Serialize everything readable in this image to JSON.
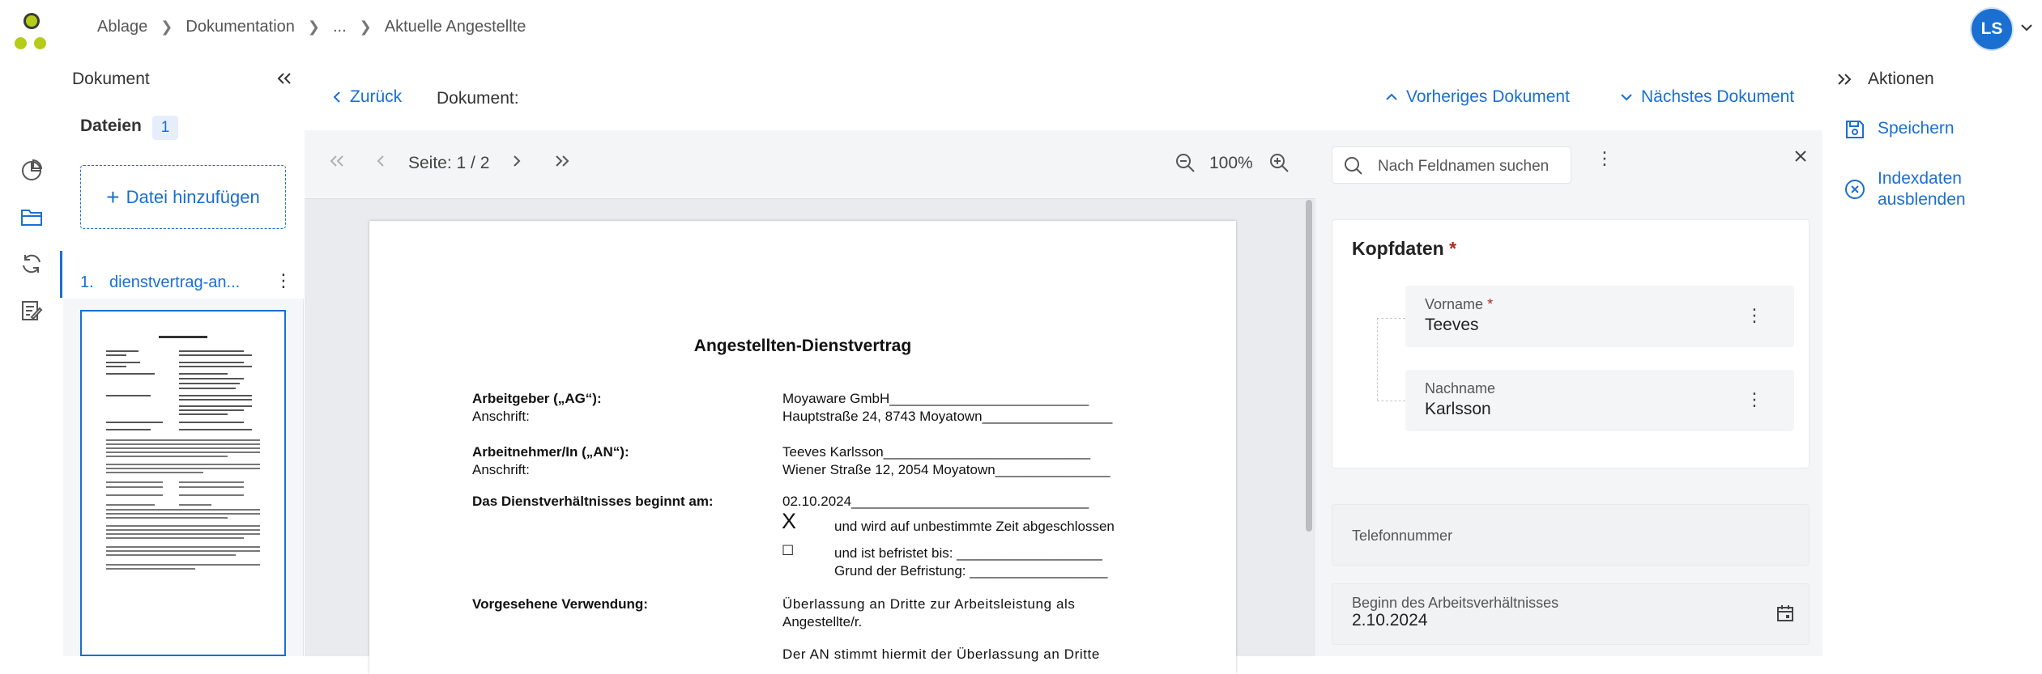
{
  "breadcrumb": [
    "Ablage",
    "Dokumentation",
    "...",
    "Aktuelle Angestellte"
  ],
  "user": {
    "initials": "LS"
  },
  "colors": {
    "accent": "#1a6fd1",
    "logo_dark": "#3a3a3a",
    "logo_green": "#b5cc18",
    "required": "#b3261e"
  },
  "rail_icons": [
    "pie-chart-icon",
    "folder-icon",
    "refresh-icon",
    "checklist-edit-icon"
  ],
  "doc_panel": {
    "title": "Dokument",
    "files_title": "Dateien",
    "files_count": "1",
    "add_file": "Datei hinzufügen",
    "file": {
      "num": "1.",
      "name": "dienstvertrag-an..."
    }
  },
  "header": {
    "back": "Zurück",
    "document_label": "Dokument:",
    "prev": "Vorheriges Dokument",
    "next": "Nächstes Dokument"
  },
  "viewer": {
    "page": "Seite: 1 / 2",
    "zoom": "100%"
  },
  "document": {
    "title": "Angestellten-Dienstvertrag",
    "employer_label": "Arbeitgeber („AG“):",
    "employer_addr_label": "Anschrift:",
    "employer_name": "Moyaware GmbH__________________________",
    "employer_addr": "Hauptstraße 24, 8743 Moyatown_________________",
    "employee_label": "Arbeitnehmer/In („AN“):",
    "employee_addr_label": "Anschrift:",
    "employee_name": "Teeves Karlsson___________________________",
    "employee_addr": "Wiener Straße 12, 2054 Moyatown_______________",
    "start_label": "Das Dienstverhältnisses beginnt am:",
    "start_value": "02.10.2024_______________________________",
    "check_mark": "X",
    "unlimited": "und wird auf unbestimmte Zeit abgeschlossen",
    "empty_box": "☐",
    "limited": "und ist befristet bis: ___________________",
    "reason": "Grund der Befristung: __________________",
    "usage_label": "Vorgesehene Verwendung:",
    "usage_line1": "Überlassung an Dritte zur Arbeitsleistung als",
    "usage_line2": "Angestellte/r.",
    "usage_line3": "Der AN stimmt hiermit der Überlassung an Dritte"
  },
  "fields_panel": {
    "search_placeholder": "Nach Feldnamen suchen",
    "group_title": "Kopfdaten",
    "firstname_label": "Vorname",
    "firstname_value": "Teeves",
    "lastname_label": "Nachname",
    "lastname_value": "Karlsson",
    "phone_label": "Telefonnummer",
    "start_label": "Beginn des Arbeitsverhältnisses",
    "start_value": "2.10.2024"
  },
  "actions": {
    "title": "Aktionen",
    "save": "Speichern",
    "hide_index_1": "Indexdaten",
    "hide_index_2": "ausblenden"
  }
}
